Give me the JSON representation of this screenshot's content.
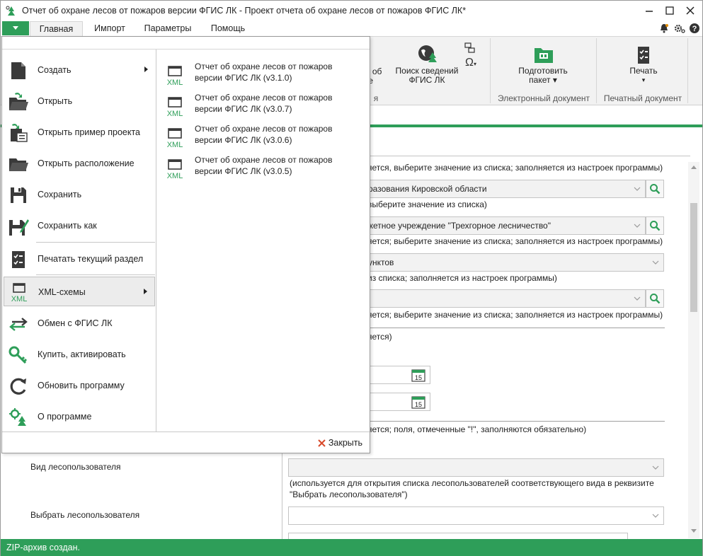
{
  "window": {
    "title": "Отчет об охране лесов от пожаров версии ФГИС ЛК - Проект отчета об охране лесов от пожаров ФГИС ЛК*"
  },
  "menubar": {
    "tabs": [
      "Главная",
      "Импорт",
      "Параметры",
      "Помощь"
    ]
  },
  "ribbon": {
    "partial_label_1": "ля об",
    "partial_label_2": "сте",
    "partial_group": "я",
    "search_label_1": "Поиск сведений",
    "search_label_2": "ФГИС ЛК",
    "prepare_label_1": "Подготовить",
    "prepare_label_2": "пакет ▾",
    "print_label": "Печать",
    "print_arrow": "▾",
    "group_electronic": "Электронный документ",
    "group_print": "Печатный документ"
  },
  "form": {
    "hint_1": "яется, выберите значение из списка; заполняется из настроек программы)",
    "combo_1": "разования Кировской области",
    "hint_2": "выберите значение из списка)",
    "combo_2": "джетное учреждение \"Трехгорное лесничество\"",
    "hint_3": "яется; выберите значение из списка; заполняется из настроек программы)",
    "combo_3": "унктов",
    "hint_4": "из списка; заполняется из настроек программы)",
    "combo_4": "",
    "hint_5": "яется; выберите значение из списка; заполняется из настроек программы)",
    "hint_6": "яется)",
    "date_icon_day": "15",
    "hint_7": "яется; поля, отмеченные \"!\", заполняются обязательно)",
    "label_user_type": "Вид лесопользователя",
    "hint_user_type_1": "(используется для открытия списка лесопользователей соответствующего вида в реквизите",
    "hint_user_type_2": "\"Выбрать лесопользователя\")",
    "label_choose_user": "Выбрать лесопользователя"
  },
  "status": {
    "text": "ZIP-архив создан."
  },
  "backstage": {
    "menu": [
      {
        "label": "Создать",
        "icon": "new-document-icon",
        "submenu": true
      },
      {
        "label": "Открыть",
        "icon": "open-folder-icon",
        "submenu": false
      },
      {
        "label": "Открыть пример проекта",
        "icon": "open-example-icon",
        "submenu": false
      },
      {
        "label": "Открыть расположение",
        "icon": "folder-icon",
        "submenu": false
      },
      {
        "label": "Сохранить",
        "icon": "save-icon",
        "submenu": false
      },
      {
        "label": "Сохранить как",
        "icon": "save-as-icon",
        "submenu": false
      },
      {
        "label": "Печатать текущий раздел",
        "icon": "print-section-icon",
        "submenu": false
      },
      {
        "label": "XML-схемы",
        "icon": "xml-schema-icon",
        "submenu": true
      },
      {
        "label": "Обмен с ФГИС ЛК",
        "icon": "exchange-icon",
        "submenu": false
      },
      {
        "label": "Купить, активировать",
        "icon": "key-icon",
        "submenu": false
      },
      {
        "label": "Обновить программу",
        "icon": "refresh-icon",
        "submenu": false
      },
      {
        "label": "О программе",
        "icon": "about-icon",
        "submenu": false
      }
    ],
    "submenu_items": [
      {
        "line1": "Отчет об охране лесов от пожаров",
        "line2": "версии ФГИС ЛК (v3.1.0)"
      },
      {
        "line1": "Отчет об охране лесов от пожаров",
        "line2": "версии ФГИС ЛК (v3.0.7)"
      },
      {
        "line1": "Отчет об охране лесов от пожаров",
        "line2": "версии ФГИС ЛК (v3.0.6)"
      },
      {
        "line1": "Отчет об охране лесов от пожаров",
        "line2": "версии ФГИС ЛК (v3.0.5)"
      }
    ],
    "xml_icon_text": "XML",
    "close_label": "Закрыть"
  },
  "colors": {
    "accent": "#2e9e59",
    "dark_icon": "#3a3a3a"
  }
}
